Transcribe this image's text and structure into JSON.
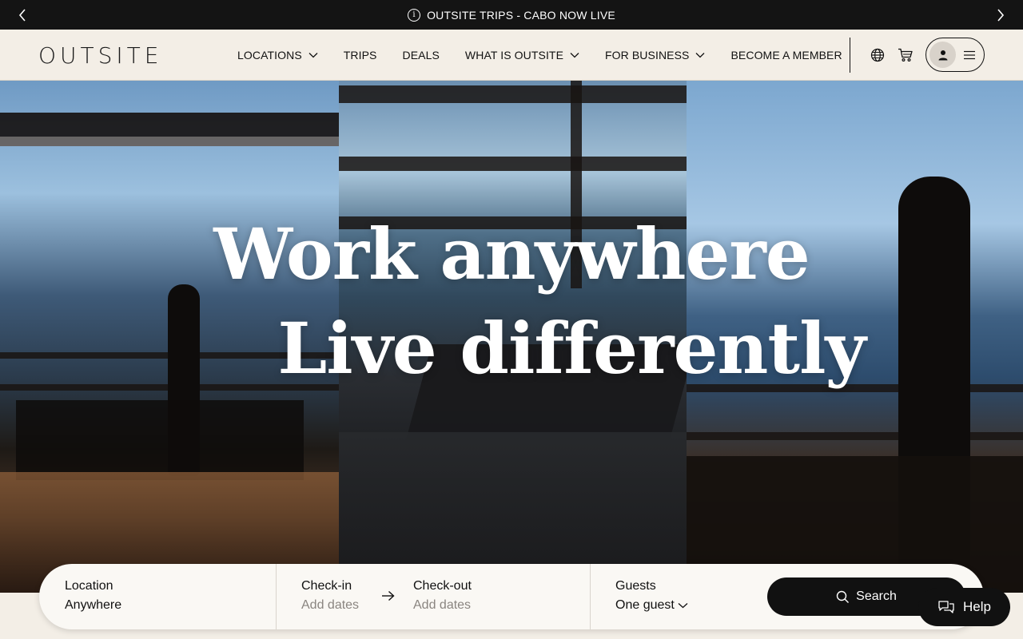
{
  "announcement": {
    "text": "OUTSITE TRIPS - CABO NOW LIVE",
    "icon": "info-icon"
  },
  "header": {
    "logo": "OUTSITE",
    "nav": [
      {
        "label": "LOCATIONS",
        "has_dropdown": true
      },
      {
        "label": "TRIPS",
        "has_dropdown": false
      },
      {
        "label": "DEALS",
        "has_dropdown": false
      },
      {
        "label": "WHAT IS OUTSITE",
        "has_dropdown": true
      },
      {
        "label": "FOR BUSINESS",
        "has_dropdown": true
      },
      {
        "label": "BECOME A MEMBER",
        "has_dropdown": false
      }
    ],
    "icons": [
      "globe-icon",
      "cart-icon",
      "user-icon",
      "menu-icon"
    ]
  },
  "hero": {
    "line1": "Work anywhere",
    "line2": "Live differently"
  },
  "search": {
    "location_label": "Location",
    "location_value": "Anywhere",
    "checkin_label": "Check-in",
    "checkin_value": "Add dates",
    "checkout_label": "Check-out",
    "checkout_value": "Add dates",
    "guests_label": "Guests",
    "guests_value": "One guest",
    "button_label": "Search"
  },
  "help": {
    "label": "Help"
  },
  "colors": {
    "background": "#f3eee6",
    "announcement_bg": "#141414",
    "button_bg": "#111111"
  }
}
